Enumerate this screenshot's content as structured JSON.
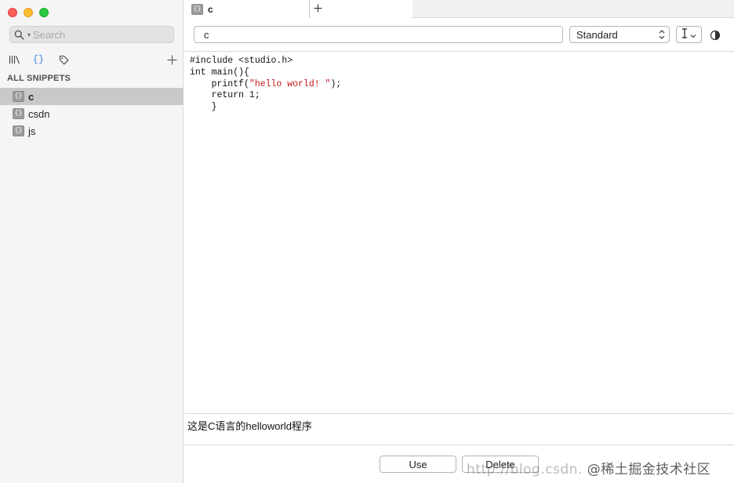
{
  "sidebar": {
    "search_placeholder": "Search",
    "section_title": "ALL SNIPPETS",
    "snippets_icon_glyph": "{}",
    "items": [
      {
        "label": "c",
        "selected": true
      },
      {
        "label": "csdn",
        "selected": false
      },
      {
        "label": "js",
        "selected": false
      }
    ]
  },
  "tabs": [
    {
      "label": "c",
      "active": true
    }
  ],
  "toolbar": {
    "title_value": "c",
    "language_value": "Standard"
  },
  "code": {
    "lines": [
      "#include <studio.h>",
      "int main(){",
      "    printf(",
      "\"hello world! \"",
      ");",
      "    return 1;",
      "    }"
    ]
  },
  "description": "这是C语言的helloworld程序",
  "buttons": {
    "use": "Use",
    "delete": "Delete"
  },
  "watermark": {
    "url": "http://blog.csdn.",
    "site": "@稀土掘金技术社区"
  },
  "colors": {
    "accent": "#3a86e8",
    "string": "#c41a16",
    "selection": "#c9c9c9"
  }
}
